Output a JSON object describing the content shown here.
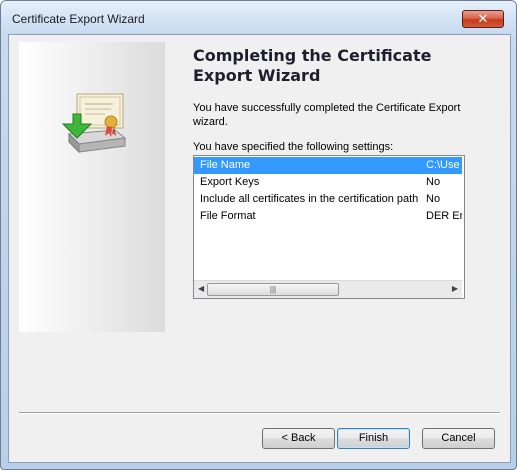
{
  "window": {
    "title": "Certificate Export Wizard"
  },
  "icons": {
    "close": "close-icon",
    "side": "certificate-export-icon"
  },
  "page": {
    "heading": "Completing the Certificate Export Wizard",
    "description": "You have successfully completed the Certificate Export wizard.",
    "settings_label": "You have specified the following settings:"
  },
  "settings": [
    {
      "name": "File Name",
      "value": "C:\\Use",
      "selected": true
    },
    {
      "name": "Export Keys",
      "value": "No",
      "selected": false
    },
    {
      "name": "Include all certificates in the certification path",
      "value": "No",
      "selected": false
    },
    {
      "name": "File Format",
      "value": "DER En",
      "selected": false
    }
  ],
  "buttons": {
    "back": "< Back",
    "finish": "Finish",
    "cancel": "Cancel"
  },
  "colors": {
    "selection": "#3399ff",
    "close_button": "#c53b1c"
  }
}
